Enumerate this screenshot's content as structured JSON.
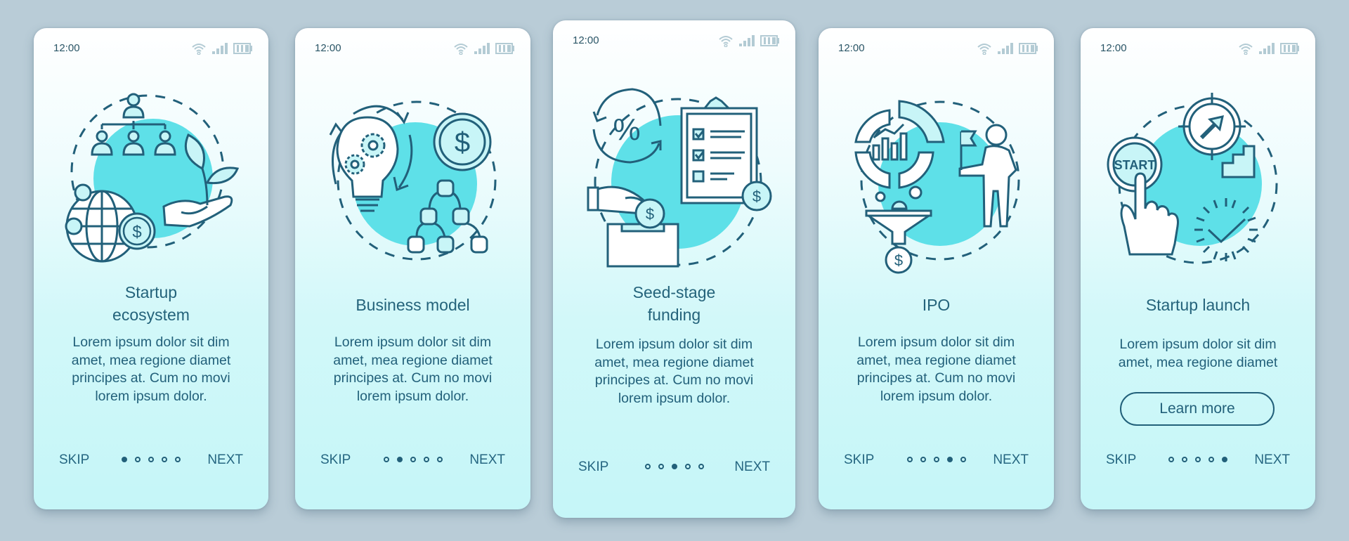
{
  "colors": {
    "background": "#b9ccd7",
    "text": "#22607a",
    "accent_blob": "#5ee0e8",
    "icon_stroke": "#22607a",
    "status_icons": "#b0c9d2"
  },
  "status_bar": {
    "time": "12:00",
    "icons": [
      "wifi-icon",
      "signal-icon",
      "battery-icon"
    ]
  },
  "screens": [
    {
      "illustration": "startup-ecosystem-illustration",
      "title_lines": [
        "Startup",
        "ecosystem"
      ],
      "body_lines": [
        "Lorem ipsum dolor sit dim",
        "amet, mea regione diamet",
        "principes at. Cum no movi",
        "lorem ipsum dolor."
      ],
      "skip": "SKIP",
      "next": "NEXT",
      "active_dot": 1,
      "total_dots": 5
    },
    {
      "illustration": "business-model-illustration",
      "title_lines": [
        "Business model"
      ],
      "body_lines": [
        "Lorem ipsum dolor sit dim",
        "amet, mea regione diamet",
        "principes at. Cum no movi",
        "lorem ipsum dolor."
      ],
      "skip": "SKIP",
      "next": "NEXT",
      "active_dot": 2,
      "total_dots": 5
    },
    {
      "illustration": "seed-stage-funding-illustration",
      "title_lines": [
        "Seed-stage",
        "funding"
      ],
      "body_lines": [
        "Lorem ipsum dolor sit dim",
        "amet, mea regione diamet",
        "principes at. Cum no movi",
        "lorem ipsum dolor."
      ],
      "skip": "SKIP",
      "next": "NEXT",
      "active_dot": 3,
      "total_dots": 5
    },
    {
      "illustration": "ipo-illustration",
      "title_lines": [
        "IPO"
      ],
      "body_lines": [
        "Lorem ipsum dolor sit dim",
        "amet, mea regione diamet",
        "principes at. Cum no movi",
        "lorem ipsum dolor."
      ],
      "skip": "SKIP",
      "next": "NEXT",
      "active_dot": 4,
      "total_dots": 5
    },
    {
      "illustration": "startup-launch-illustration",
      "title_lines": [
        "Startup launch"
      ],
      "body_lines": [
        "Lorem ipsum dolor sit dim",
        "amet, mea regione diamet"
      ],
      "button": "Learn more",
      "start_label": "START",
      "skip": "SKIP",
      "next": "NEXT",
      "active_dot": 5,
      "total_dots": 5
    }
  ]
}
